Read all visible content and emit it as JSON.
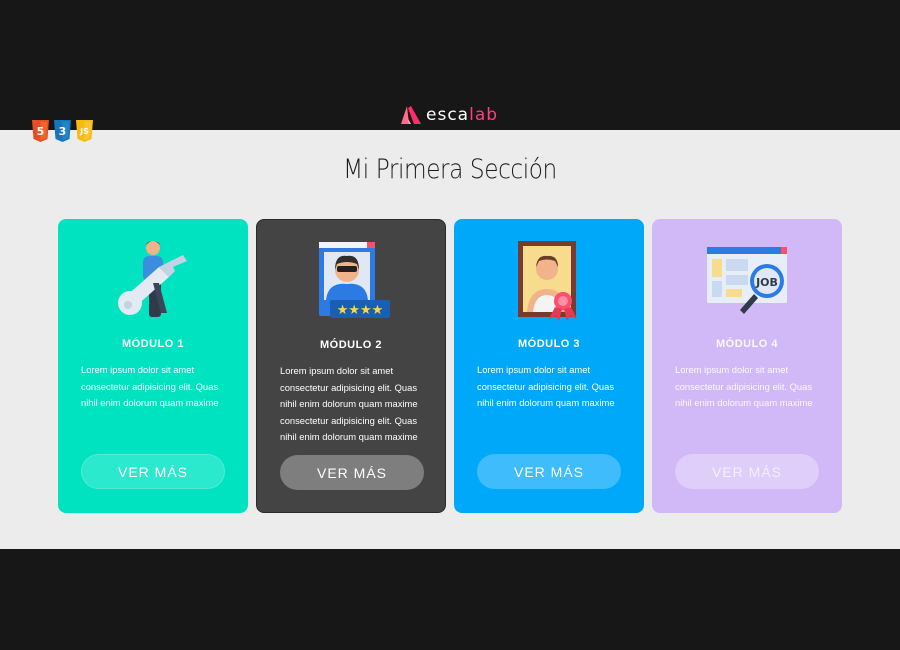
{
  "header": {
    "logo": {
      "part1": "esca",
      "part2": "lab"
    },
    "badges": [
      {
        "name": "html5",
        "label": "5",
        "color": "#e44d26"
      },
      {
        "name": "css3",
        "label": "3",
        "color": "#1b73ba"
      },
      {
        "name": "js",
        "label": "JS",
        "color": "#f7ba15"
      }
    ]
  },
  "section": {
    "title": "Mi Primera Sección",
    "cards": [
      {
        "icon": "key-person-icon",
        "title": "MÓDULO 1",
        "text": "Lorem ipsum dolor sit amet consectetur adipisicing elit. Quas nihil enim dolorum quam maxime",
        "button": "VER MÁS",
        "color": "#00e3c0"
      },
      {
        "icon": "rated-profile-icon",
        "title": "MÓDULO 2",
        "text": "Lorem ipsum dolor sit amet consectetur adipisicing elit. Quas nihil enim dolorum quam maxime consectetur adipisicing elit. Quas nihil enim dolorum quam maxime",
        "button": "VER MÁS",
        "color": "#444444"
      },
      {
        "icon": "portrait-award-icon",
        "title": "MÓDULO 3",
        "text": "Lorem ipsum dolor sit amet consectetur adipisicing elit. Quas nihil enim dolorum quam maxime",
        "button": "VER MÁS",
        "color": "#00a8fa"
      },
      {
        "icon": "job-search-icon",
        "title": "MÓDULO 4",
        "text": "Lorem ipsum dolor sit amet consectetur adipisicing elit. Quas nihil enim dolorum quam maxime",
        "button": "VER MÁS",
        "color": "#d1b8f7"
      }
    ]
  }
}
